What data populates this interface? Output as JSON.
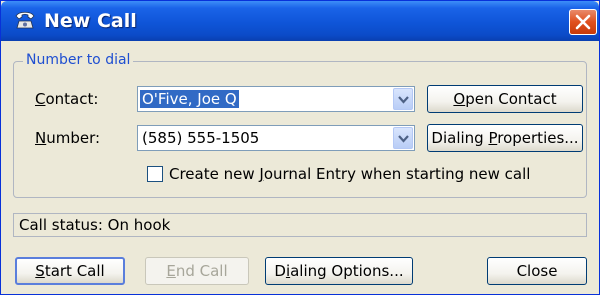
{
  "window": {
    "title": "New Call"
  },
  "group": {
    "legend": "Number to dial"
  },
  "contact": {
    "label_pre": "",
    "label_ul": "C",
    "label_post": "ontact:",
    "value": "O'Five, Joe Q"
  },
  "number": {
    "label_pre": "",
    "label_ul": "N",
    "label_post": "umber:",
    "value": "(585) 555-1505"
  },
  "buttons": {
    "open_contact": {
      "pre": "",
      "ul": "O",
      "post": "pen Contact"
    },
    "dialing_properties": {
      "pre": "Dialing ",
      "ul": "P",
      "post": "roperties..."
    },
    "start_call": {
      "pre": "",
      "ul": "S",
      "post": "tart Call"
    },
    "end_call": {
      "pre": "",
      "ul": "E",
      "post": "nd Call"
    },
    "dialing_options": {
      "pre": "D",
      "ul": "i",
      "post": "aling Options..."
    },
    "close": "Close"
  },
  "journal": {
    "pre": "Create new ",
    "ul": "J",
    "post": "ournal Entry when starting new call",
    "checked": false
  },
  "status": {
    "text": "Call status: On hook"
  },
  "colors": {
    "title_bar": "#0b4bc8",
    "dialog_bg": "#ece9d8",
    "close": "#e0501e",
    "legend": "#1f4fd1"
  }
}
